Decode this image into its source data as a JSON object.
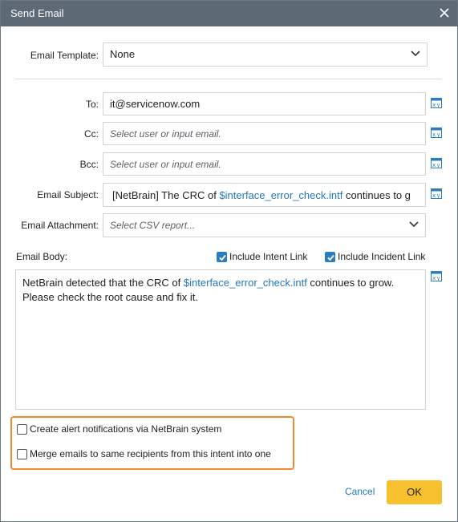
{
  "window": {
    "title": "Send Email"
  },
  "form": {
    "template": {
      "label": "Email Template:",
      "value": "None"
    },
    "to": {
      "label": "To:",
      "value": "it@servicenow.com"
    },
    "cc": {
      "label": "Cc:",
      "placeholder": "Select user or input email."
    },
    "bcc": {
      "label": "Bcc:",
      "placeholder": "Select user or input email."
    },
    "subject": {
      "label": "Email Subject:",
      "prefix": "[NetBrain] The CRC of ",
      "variable": "$interface_error_check.intf",
      "suffix": " continues to g"
    },
    "attachment": {
      "label": "Email Attachment:",
      "placeholder": "Select CSV report..."
    },
    "body": {
      "label": "Email Body:",
      "include_intent_link": {
        "label": "Include Intent Link",
        "checked": true
      },
      "include_incident_link": {
        "label": "Include Incident Link",
        "checked": true
      },
      "line1_prefix": "NetBrain detected that the CRC of ",
      "line1_variable": "$interface_error_check.intf",
      "line1_suffix": " continues to grow.",
      "line2": "Please check the root cause and fix it."
    }
  },
  "options": {
    "create_alert": {
      "label": "Create alert notifications via NetBrain system",
      "checked": false
    },
    "merge_emails": {
      "label": "Merge emails to same recipients from this intent into one",
      "checked": false
    }
  },
  "footer": {
    "cancel_label": "Cancel",
    "ok_label": "OK"
  },
  "colors": {
    "titlebar": "#5d6975",
    "accent": "#2c7dc0",
    "link": "#2479b8",
    "highlight": "#f28a2b",
    "ok_button": "#f7c02f"
  },
  "icons": {
    "close": "close-icon",
    "variable": "variable-insert-icon",
    "dropdown": "chevron-down-icon",
    "check": "check-icon"
  }
}
